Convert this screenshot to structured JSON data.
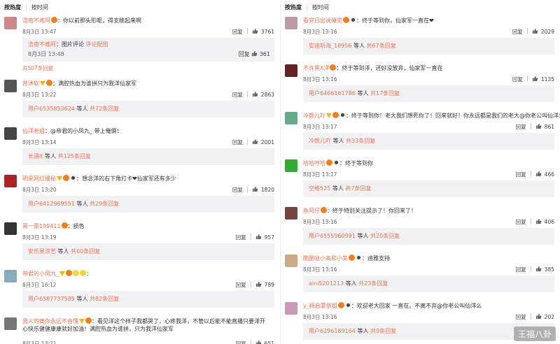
{
  "left": {
    "sort": {
      "hot": "按热度",
      "time": "按时间"
    },
    "comments": [
      {
        "user": "浩南不难阿",
        "text": "：你以前那头形呢，得支棱起来啊",
        "date": "8月3日 13:47",
        "reply": "回复",
        "likes": "3761",
        "avatar_color": "#c88",
        "badges": [
          "m"
        ],
        "sub": {
          "type": "inline",
          "user": "浩南不难阿",
          "text": "：图片评论",
          "link": "评论配图",
          "date": "8月3日 13:48",
          "likes": "361",
          "reply": "回复"
        },
        "more": "共507条回复"
      },
      {
        "user": "苏沐软",
        "text": "：满腔热血为谁拼只为我洋仙家军",
        "date": "8月3日 13:22",
        "reply": "回复",
        "likes": "2863",
        "avatar_color": "#555",
        "badges": [
          "v",
          "m"
        ],
        "sub": {
          "type": "box",
          "user": "用户6535853624",
          "mid": " 等人 ",
          "more": "共72条回复"
        }
      },
      {
        "user": "仙洋老姐",
        "text": "：@帝君的小凤九_ 带上俺俩！",
        "date": "8月3日 13:14",
        "reply": "回复",
        "likes": "2001",
        "avatar_color": "#444",
        "badges": [],
        "sub": {
          "type": "box",
          "user": "长涌It",
          "mid": " 等人 ",
          "more": "共125条回复"
        }
      },
      {
        "user": "明星网红播秘",
        "text": "：想念洋的右下角打卡❤仙家军还有多少",
        "date": "8月3日 13:20",
        "reply": "回复",
        "likes": "1820",
        "avatar_color": "#a22",
        "badges": [
          "v",
          "m",
          "p"
        ],
        "sub": {
          "type": "box",
          "user": "用户6412969551",
          "mid": " 等人 ",
          "more": "共29条回复"
        }
      },
      {
        "user": "蒋一豪199411",
        "text": "：损色",
        "date": "8月3日 13:19",
        "reply": "回复",
        "likes": "957",
        "avatar_color": "#333",
        "badges": [
          "m"
        ],
        "sub": {
          "type": "box",
          "user": "安乐黑涂艺",
          "mid": " 等人 ",
          "more": "共60条回复"
        }
      },
      {
        "user": "帝君的小凤九_",
        "text": "：",
        "date": "8月3日 16:12",
        "reply": "回复",
        "likes": "789",
        "avatar_color": "#8ab",
        "badges": [
          "v",
          "m",
          "y",
          "y"
        ],
        "sub": {
          "type": "box",
          "user": "用户6587737585",
          "mid": " 等人 ",
          "more": "共82条回复"
        }
      },
      {
        "user": "男人的痛你永远不会懂",
        "text": "：看见洋这个样子我都哭了，心疼我洋，不管以后能不能直播只要洋开心快乐健健康康就好加油！满腔热血为谁拼，只为我洋仙家军",
        "date": "8月3日 13:21",
        "reply": "回复",
        "likes": "651",
        "avatar_color": "#777",
        "badges": [
          "v",
          "m"
        ]
      }
    ]
  },
  "right": {
    "sort": {
      "hot": "按热度",
      "time": "按时间"
    },
    "comments": [
      {
        "user": "看完日出说睡觉",
        "text": "：终于等到你，仙家军一直在❤",
        "date": "8月3日 13:16",
        "reply": "回复",
        "likes": "2029",
        "avatar_color": "#b9a",
        "badges": [
          "m",
          "p"
        ],
        "sub": {
          "type": "box",
          "user": "安迪听海_18956",
          "mid": " 等人 ",
          "more": "共67条回复"
        }
      },
      {
        "user": "不许黑X洋",
        "text": "：终于等到洋，还好没放弃，仙家军一直在",
        "date": "8月3日 13:16",
        "reply": "回复",
        "likes": "1135",
        "avatar_color": "#622",
        "badges": [
          "m"
        ],
        "sub": {
          "type": "box",
          "user": "用户6466161786",
          "mid": " 等人 ",
          "more": "共17条回复"
        }
      },
      {
        "user": "冷颜儿吖",
        "text": "：终于等到你！老大我们想死你了！回来就好！你永远都是我们的老大@你老公叫仙洋么",
        "date": "8月3日 13:17",
        "reply": "回复",
        "likes": "861",
        "avatar_color": "#6a8",
        "badges": [
          "v",
          "m",
          "p"
        ],
        "sub": {
          "type": "box",
          "user": "冷颜儿吖",
          "mid": " 等人 ",
          "more": "共33条回复"
        }
      },
      {
        "user": "哈哈哼哈",
        "text": "：终于等到你",
        "date": "8月3日 13:17",
        "reply": "回复",
        "likes": "466",
        "avatar_color": "#3a3",
        "badges": [
          "m",
          "p"
        ],
        "sub": {
          "type": "box",
          "user": "空格525",
          "mid": " 等人 ",
          "more": "共7条回复"
        }
      },
      {
        "user": "鱼阿仔",
        "text": "：终于特别关注提示了！你回来了！",
        "date": "8月3日 13:16",
        "reply": "回复",
        "likes": "406",
        "avatar_color": "#744",
        "badges": [
          "m"
        ],
        "sub": {
          "type": "box",
          "user": "用户6555960991",
          "mid": " 等人 ",
          "more": "共20条回复"
        }
      },
      {
        "user": "酷酷哒小高和小美",
        "text": "：迪雅支持",
        "date": "8月3日 13:16",
        "reply": "回复",
        "likes": "385",
        "avatar_color": "#ca8",
        "badges": [
          "m",
          "p"
        ],
        "sub": {
          "type": "box",
          "user": "aini5201213",
          "mid": " 等人 ",
          "more": "共23条回复"
        }
      },
      {
        "user": "y_杨启蒙依姐",
        "text": "：欢迎老大回家    一直在。不离不弃@你老公叫仙洋么",
        "date": "8月3日 13:16",
        "reply": "回复",
        "likes": "202",
        "avatar_color": "#c9b",
        "badges": [
          "m",
          "p"
        ],
        "sub": {
          "type": "box",
          "user": "用户6296189164",
          "mid": " 等人 ",
          "more": "共9条回复"
        }
      }
    ]
  },
  "watermark": "王福八卦"
}
